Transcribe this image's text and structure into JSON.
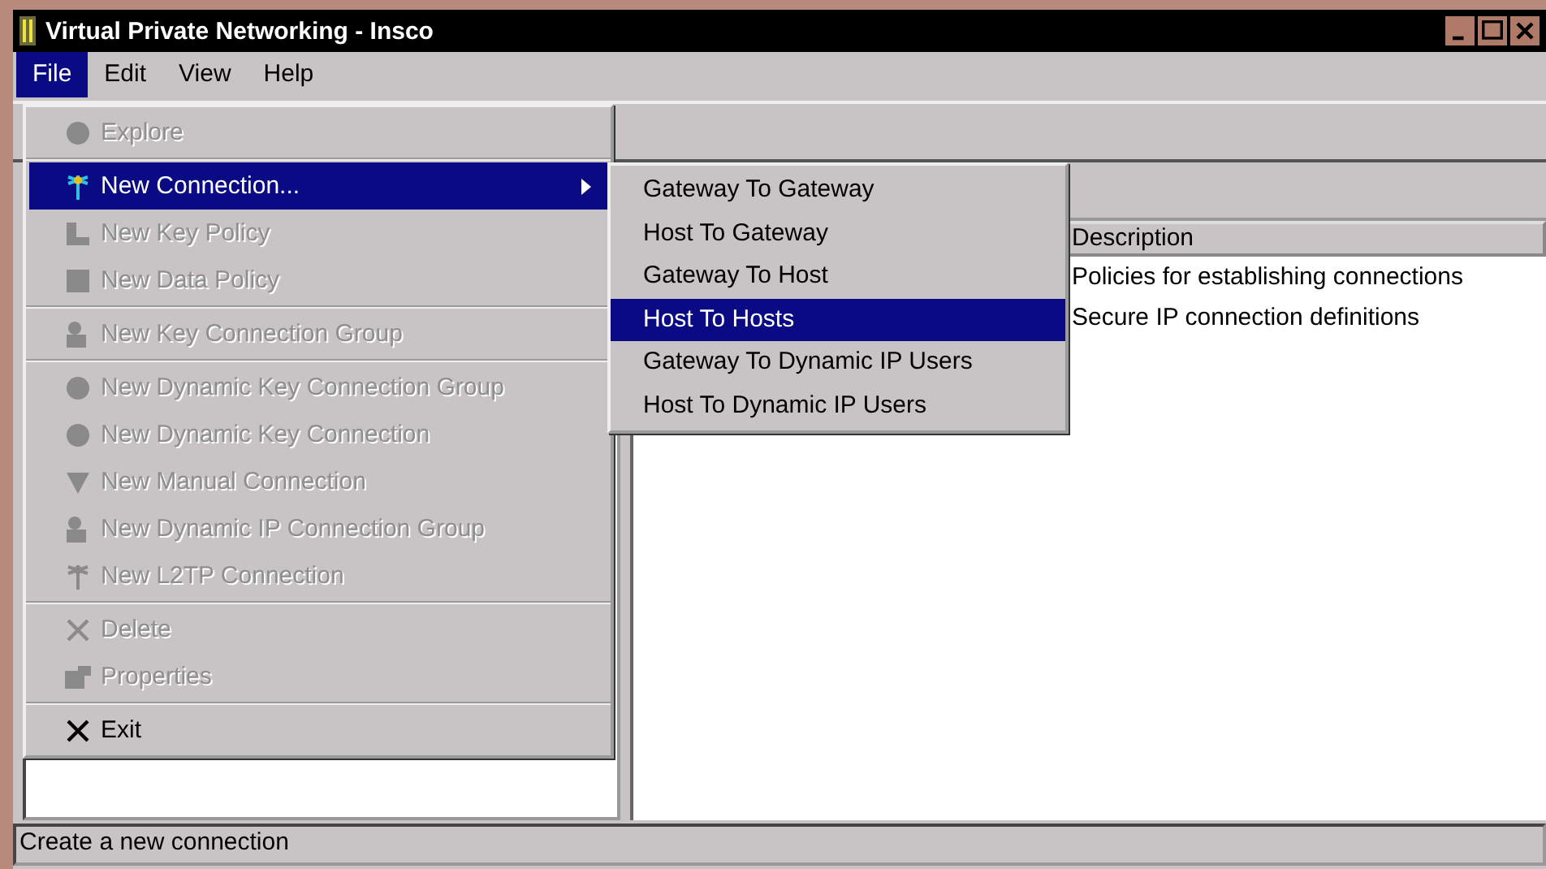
{
  "window": {
    "title": "Virtual Private Networking - Insco"
  },
  "menubar": [
    {
      "label": "File",
      "selected": true
    },
    {
      "label": "Edit",
      "selected": false
    },
    {
      "label": "View",
      "selected": false
    },
    {
      "label": "Help",
      "selected": false
    }
  ],
  "file_menu": {
    "groups": [
      [
        {
          "label": "Explore",
          "disabled": true,
          "selected": false,
          "submenu": false
        }
      ],
      [
        {
          "label": "New Connection...",
          "disabled": false,
          "selected": true,
          "submenu": true
        },
        {
          "label": "New Key Policy",
          "disabled": true,
          "selected": false,
          "submenu": false
        },
        {
          "label": "New Data Policy",
          "disabled": true,
          "selected": false,
          "submenu": false
        }
      ],
      [
        {
          "label": "New Key Connection Group",
          "disabled": true,
          "selected": false,
          "submenu": false
        }
      ],
      [
        {
          "label": "New Dynamic Key Connection Group",
          "disabled": true,
          "selected": false,
          "submenu": false
        },
        {
          "label": "New Dynamic Key Connection",
          "disabled": true,
          "selected": false,
          "submenu": false
        },
        {
          "label": "New Manual Connection",
          "disabled": true,
          "selected": false,
          "submenu": false
        },
        {
          "label": "New Dynamic IP Connection Group",
          "disabled": true,
          "selected": false,
          "submenu": false
        },
        {
          "label": "New L2TP Connection",
          "disabled": true,
          "selected": false,
          "submenu": false
        }
      ],
      [
        {
          "label": "Delete",
          "disabled": true,
          "selected": false,
          "submenu": false
        },
        {
          "label": "Properties",
          "disabled": true,
          "selected": false,
          "submenu": false
        }
      ],
      [
        {
          "label": "Exit",
          "disabled": false,
          "selected": false,
          "submenu": false
        }
      ]
    ]
  },
  "submenu": [
    {
      "label": "Gateway To Gateway",
      "selected": false
    },
    {
      "label": "Host To Gateway",
      "selected": false
    },
    {
      "label": "Gateway To Host",
      "selected": false
    },
    {
      "label": "Host To Hosts",
      "selected": true
    },
    {
      "label": "Gateway To Dynamic IP Users",
      "selected": false
    },
    {
      "label": "Host To Dynamic IP Users",
      "selected": false
    }
  ],
  "table": {
    "columns": [
      "Description"
    ],
    "rows": [
      {
        "description": "Policies for establishing connections"
      },
      {
        "description": "Secure IP connection definitions"
      }
    ]
  },
  "status_bar": "Create a new connection"
}
